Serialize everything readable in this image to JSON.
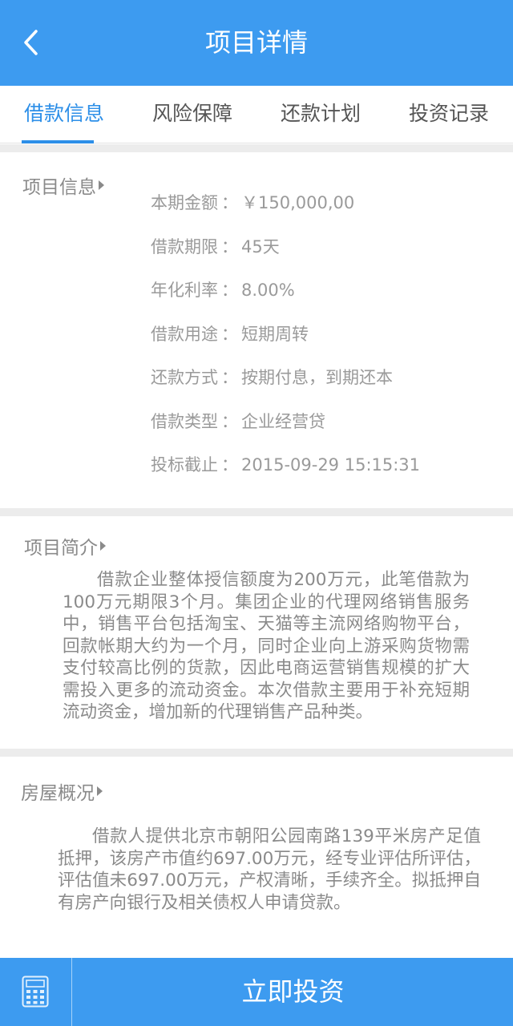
{
  "header": {
    "title": "项目详情",
    "back_icon": "chevron-left-icon"
  },
  "tabs": [
    {
      "label": "借款信息",
      "active": true
    },
    {
      "label": "风险保障",
      "active": false
    },
    {
      "label": "还款计划",
      "active": false
    },
    {
      "label": "投资记录",
      "active": false
    }
  ],
  "project_info": {
    "title": "项目信息",
    "rows": [
      {
        "label": "本期金额",
        "value": "￥150,000,00"
      },
      {
        "label": "借款期限",
        "value": "45天"
      },
      {
        "label": "年化利率",
        "value": "8.00%"
      },
      {
        "label": "借款用途",
        "value": "短期周转"
      },
      {
        "label": "还款方式",
        "value": "按期付息，到期还本"
      },
      {
        "label": "借款类型",
        "value": "企业经营贷"
      },
      {
        "label": "投标截止",
        "value": "2015-09-29 15:15:31"
      }
    ]
  },
  "project_summary": {
    "title": "项目简介",
    "text": "借款企业整体授信额度为200万元，此笔借款为100万元期限3个月。集团企业的代理网络销售服务中，销售平台包括淘宝、天猫等主流网络购物平台，回款帐期大约为一个月，同时企业向上游采购货物需支付较高比例的货款，因此电商运营销售规模的扩大需投入更多的流动资金。本次借款主要用于补充短期流动资金，增加新的代理销售产品种类。"
  },
  "house_overview": {
    "title": "房屋概况",
    "text": "借款人提供北京市朝阳公园南路139平米房产足值抵押，该房产市值约697.00万元，经专业评估所评估，评估值未697.00万元，产权清晰，手续齐全。拟抵押自有房产向银行及相关债权人申请贷款。"
  },
  "footer": {
    "calculator_icon": "calculator-icon",
    "invest_label": "立即投资"
  },
  "colors": {
    "accent": "#3d9bf0",
    "active_tab": "#2d8fe8",
    "divider": "#ececec",
    "text": "#8a8a8a"
  },
  "separator": "："
}
